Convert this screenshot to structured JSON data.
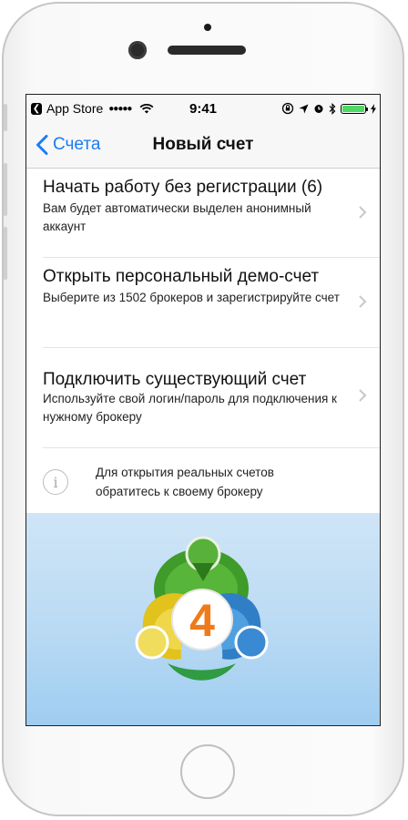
{
  "status_bar": {
    "back_app": "App Store",
    "signal": "●●●●●",
    "time": "9:41"
  },
  "nav": {
    "back_label": "Счета",
    "title": "Новый счет"
  },
  "options": [
    {
      "title": "Начать работу без регистрации (6)",
      "subtitle": "Вам будет автоматически выделен анонимный аккаунт"
    },
    {
      "title": "Открыть персональный демо-счет",
      "subtitle": "Выберите из 1502 брокеров и зарегистрируйте счет"
    },
    {
      "title": "Подключить существующий счет",
      "subtitle": "Используйте свой логин/пароль для подключения к нужному брокеру"
    }
  ],
  "info": {
    "icon": "i",
    "text": "Для открытия реальных счетов обратитесь к своему брокеру"
  },
  "logo": {
    "number": "4",
    "colors": {
      "green": "#3f9b2a",
      "yellow": "#e2c21c",
      "blue": "#2f7ec6",
      "orange": "#f07a1a"
    }
  },
  "colors": {
    "accent": "#1a7cf5",
    "battery": "#4cd964"
  }
}
